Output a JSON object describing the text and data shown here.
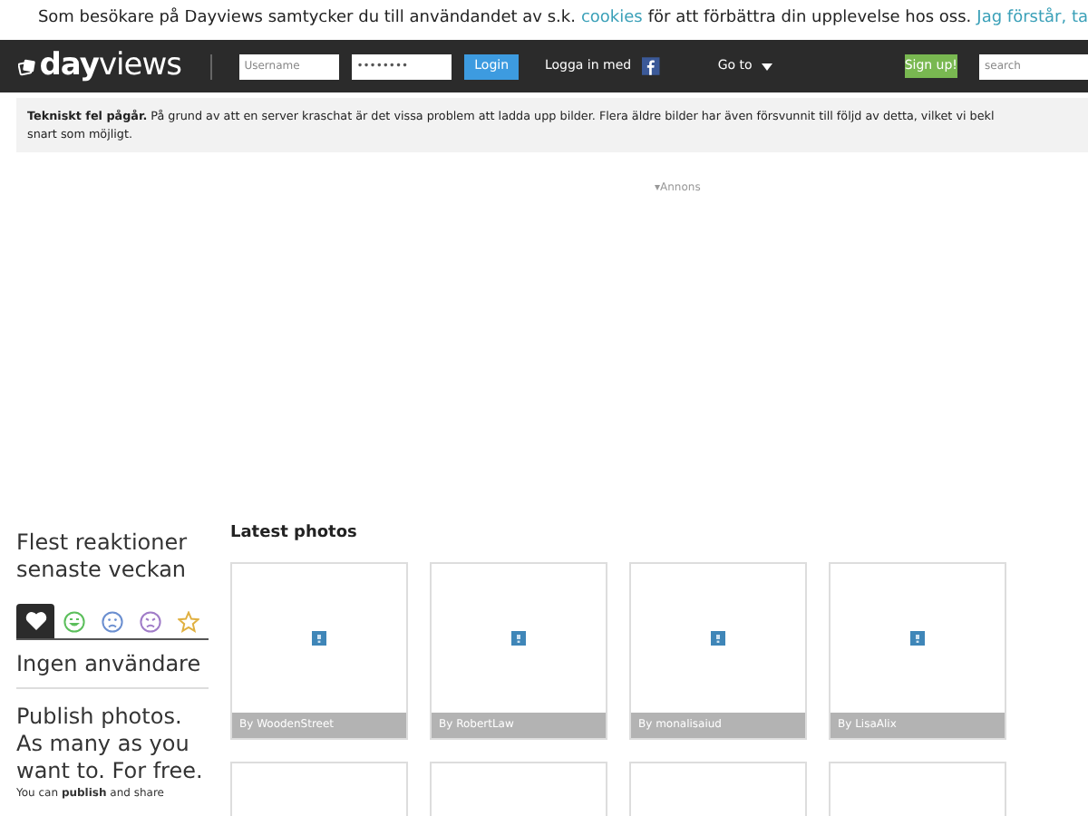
{
  "cookie_bar": {
    "text": "Som besökare på Dayviews samtycker du till användandet av s.k.",
    "link": "cookies",
    "text_after": "för att förbättra din upplevelse hos oss.",
    "accept": "Jag förstår, ta"
  },
  "navbar": {
    "logo": "**day**views",
    "username": {
      "placeholder": "Username"
    },
    "password": {
      "placeholder": "••••••••"
    },
    "login": "Login",
    "facebook_label": "Logga in med",
    "goto": "Go to",
    "signup": "Sign up!",
    "search": {
      "placeholder": "search"
    }
  },
  "notice": {
    "lines": [
      "**Tekniskt fel pågår.** På grund av att en server kraschat är det vissa problem att ladda upp bilder. Flera äldre bilder har även försvunnit till följd av detta, vilket vi bekl",
      "snart som möjligt."
    ]
  },
  "ad_label": "▾Annons",
  "sidebar": {
    "title": "Flest reaktioner senaste veckan",
    "reaction_tabs": [
      {
        "kind": "heart",
        "selected": true
      },
      {
        "kind": "laugh",
        "selected": false
      },
      {
        "kind": "sad",
        "selected": false
      },
      {
        "kind": "cry",
        "selected": false
      },
      {
        "kind": "star",
        "selected": false
      }
    ],
    "empty": "Ingen användare",
    "promo": "Publish photos. As many as you want to. For free.",
    "promo_text": "You can **publish** and share"
  },
  "latest": {
    "title": "Latest photos",
    "photos": [
      {
        "kind": "photo",
        "author": "By WoodenStreet"
      },
      {
        "kind": "photo",
        "author": "By RobertLaw"
      },
      {
        "kind": "photo",
        "author": "By monalisaiud"
      },
      {
        "kind": "photo",
        "author": "By LisaAlix"
      },
      {
        "kind": "cut"
      },
      {
        "kind": "cut"
      },
      {
        "kind": "cut"
      },
      {
        "kind": "cut"
      }
    ]
  }
}
